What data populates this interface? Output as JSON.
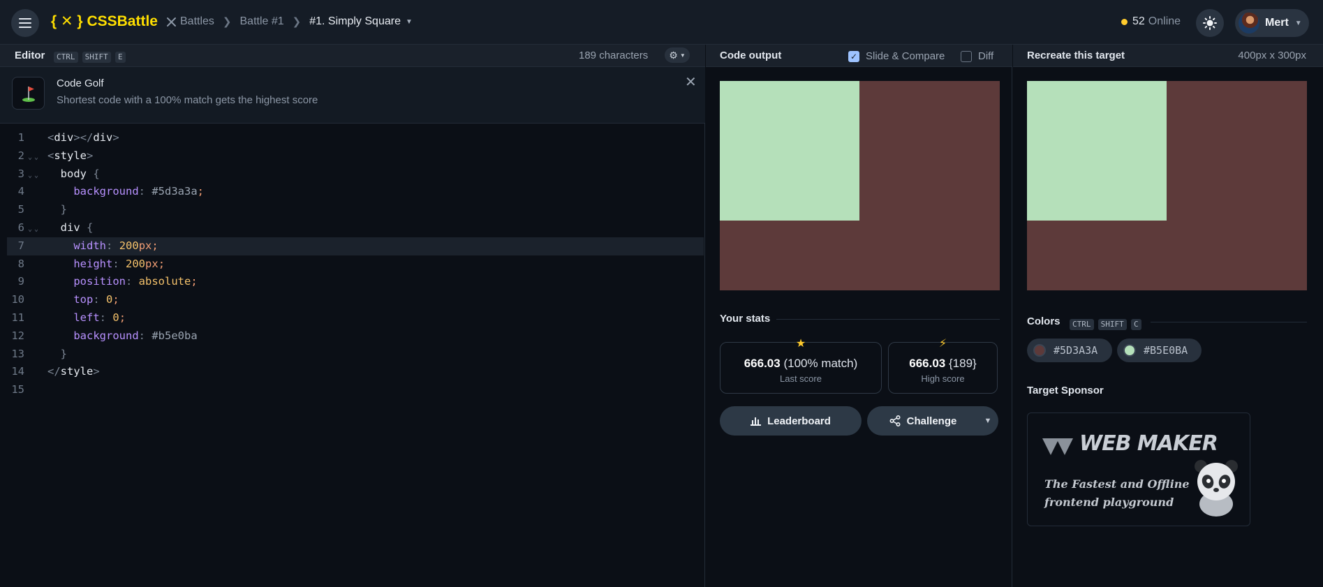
{
  "topbar": {
    "logo": "{ ✕ } CSSBattle",
    "breadcrumbs": [
      "Battles",
      "Battle #1",
      "#1. Simply Square"
    ],
    "online_count": "52",
    "online_label": "Online",
    "user_name": "Mert"
  },
  "editor": {
    "title": "Editor",
    "shortcut": [
      "CTRL",
      "SHIFT",
      "E"
    ],
    "char_count": "189 characters",
    "tip_title": "Code Golf",
    "tip_desc": "Shortest code with a 100% match gets the highest score",
    "active_line": 7,
    "lines": [
      "<div></div>",
      "<style>",
      "  body {",
      "    background: #5d3a3a;",
      "  }",
      "  div {",
      "    width: 200px;",
      "    height: 200px;",
      "    position: absolute;",
      "    top: 0;",
      "    left: 0;",
      "    background: #b5e0ba",
      "  }",
      "</style>",
      ""
    ]
  },
  "output": {
    "title": "Code output",
    "slide_compare_label": "Slide & Compare",
    "slide_compare_checked": true,
    "diff_label": "Diff",
    "diff_checked": false,
    "your_stats_label": "Your stats",
    "last_score_value": "666.03",
    "last_score_extra": "(100% match)",
    "last_score_label": "Last score",
    "high_score_value": "666.03",
    "high_score_extra": "{189}",
    "high_score_label": "High score",
    "leaderboard_label": "Leaderboard",
    "challenge_label": "Challenge"
  },
  "target": {
    "title": "Recreate this target",
    "dimensions": "400px x 300px",
    "colors_label": "Colors",
    "colors_shortcut": [
      "CTRL",
      "SHIFT",
      "C"
    ],
    "colors": [
      {
        "hex": "#5D3A3A",
        "value": "#5d3a3a"
      },
      {
        "hex": "#B5E0BA",
        "value": "#b5e0ba"
      }
    ],
    "sponsor_label": "Target Sponsor",
    "sponsor_name": "WEB MAKER",
    "sponsor_tagline": "The Fastest and Offline\nfrontend playground"
  },
  "canvas_colors": {
    "background": "#5d3a3a",
    "square": "#b5e0ba"
  },
  "icons": [
    "menu-icon",
    "crossed-swords-icon",
    "chevron-right-icon",
    "sun-icon",
    "gear-icon",
    "golf-flag-icon",
    "close-icon",
    "star-icon",
    "bolt-icon",
    "bar-chart-icon",
    "share-icon",
    "panda-icon"
  ]
}
